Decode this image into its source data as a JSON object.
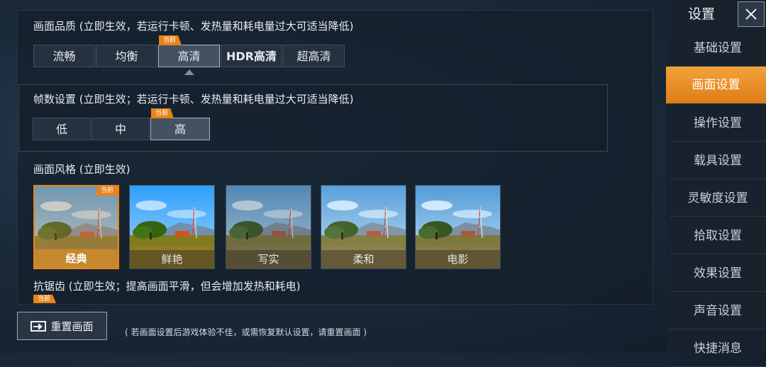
{
  "quality": {
    "title": "画面品质 (立即生效，若运行卡顿、发热量和耗电量过大可适当降低)",
    "options": [
      "流畅",
      "均衡",
      "高清",
      "HDR高清",
      "超高清"
    ],
    "selected_index": 2,
    "current_tag": "当前"
  },
  "fps": {
    "title": "帧数设置 (立即生效；若运行卡顿、发热量和耗电量过大可适当降低)",
    "options": [
      "低",
      "中",
      "高"
    ],
    "selected_index": 2,
    "current_tag": "当前"
  },
  "style": {
    "title": "画面风格 (立即生效)",
    "options": [
      "经典",
      "鲜艳",
      "写实",
      "柔和",
      "电影"
    ],
    "selected_index": 0,
    "current_tag": "当前"
  },
  "antialias": {
    "title": "抗锯齿 (立即生效；提高画面平滑，但会增加发热和耗电)",
    "current_tag": "当前"
  },
  "reset": {
    "label": "重置画面",
    "hint": "( 若画面设置后游戏体验不佳，或需恢复默认设置，请重置画面 )"
  },
  "sidebar": {
    "title": "设置",
    "items": [
      "基础设置",
      "画面设置",
      "操作设置",
      "载具设置",
      "灵敏度设置",
      "拾取设置",
      "效果设置",
      "声音设置",
      "快捷消息"
    ],
    "active_index": 1
  },
  "colors": {
    "accent": "#e8831b"
  }
}
